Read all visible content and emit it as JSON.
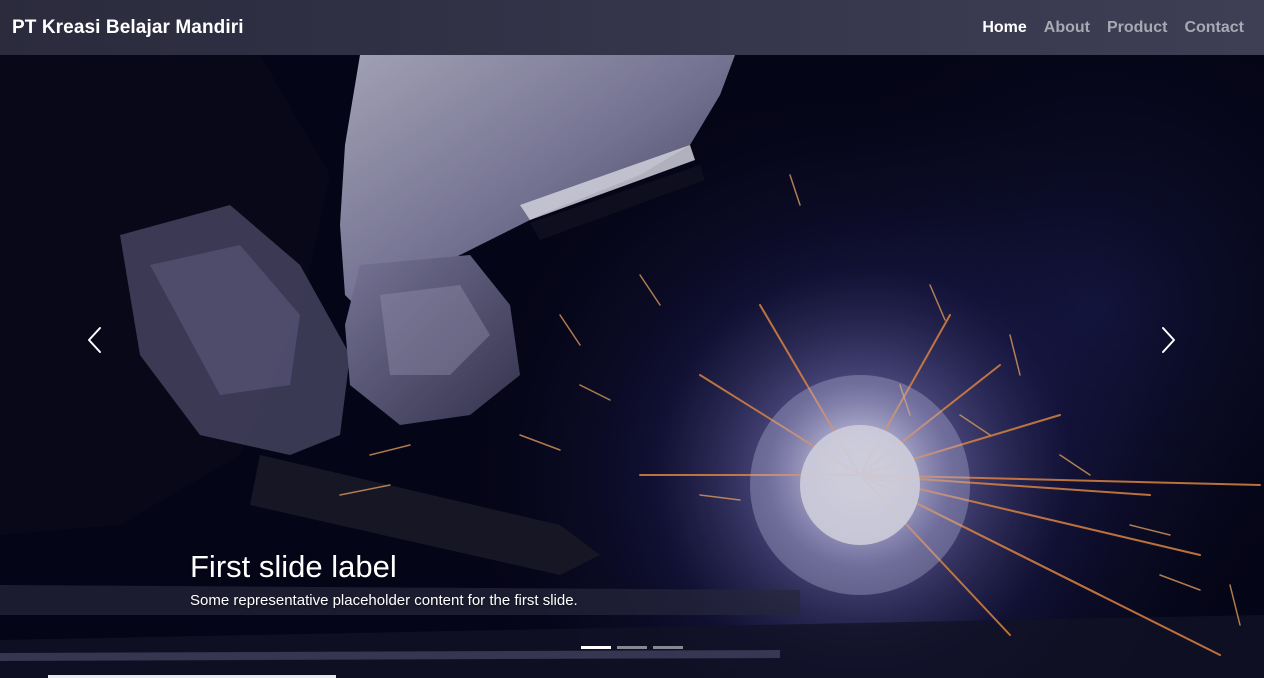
{
  "navbar": {
    "brand": "PT Kreasi Belajar Mandiri",
    "links": [
      {
        "label": "Home",
        "active": true
      },
      {
        "label": "About",
        "active": false
      },
      {
        "label": "Product",
        "active": false
      },
      {
        "label": "Contact",
        "active": false
      }
    ]
  },
  "carousel": {
    "slides": [
      {
        "title": "First slide label",
        "text": "Some representative placeholder content for the first slide."
      }
    ],
    "active_index": 0,
    "indicator_count": 3,
    "prev_icon": "chevron-left-icon",
    "next_icon": "chevron-right-icon"
  },
  "colors": {
    "navbar_bg": "#34344a",
    "nav_active": "#ffffff",
    "nav_inactive": "#a9a9b4"
  }
}
